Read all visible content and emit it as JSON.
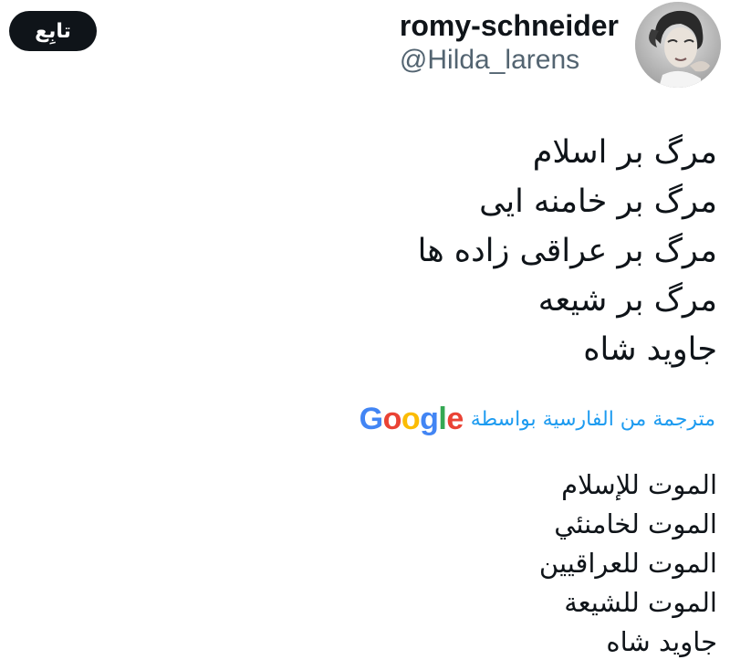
{
  "header": {
    "follow_label": "تابِع",
    "display_name": "romy-schneider",
    "handle": "@Hilda_larens"
  },
  "avatar": {
    "icon": "profile-photo"
  },
  "tweet": {
    "original_lines": [
      "مرگ بر اسلام",
      "مرگ بر خامنه ایی",
      "مرگ بر عراقی زاده ها",
      "مرگ بر شیعه",
      "جاوید شاه"
    ],
    "translation_label": "مترجمة من الفارسية بواسطة",
    "translation_provider": "Google",
    "translated_lines": [
      "الموت للإسلام",
      "الموت لخامنئي",
      "الموت للعراقيين",
      "الموت للشيعة",
      "جاويد شاه"
    ]
  },
  "colors": {
    "text": "#0f1419",
    "secondary": "#536471",
    "link": "#1d9bf0",
    "follow_bg": "#0f1419",
    "google_blue": "#4285F4",
    "google_red": "#EA4335",
    "google_yellow": "#FBBC05",
    "google_green": "#34A853"
  }
}
